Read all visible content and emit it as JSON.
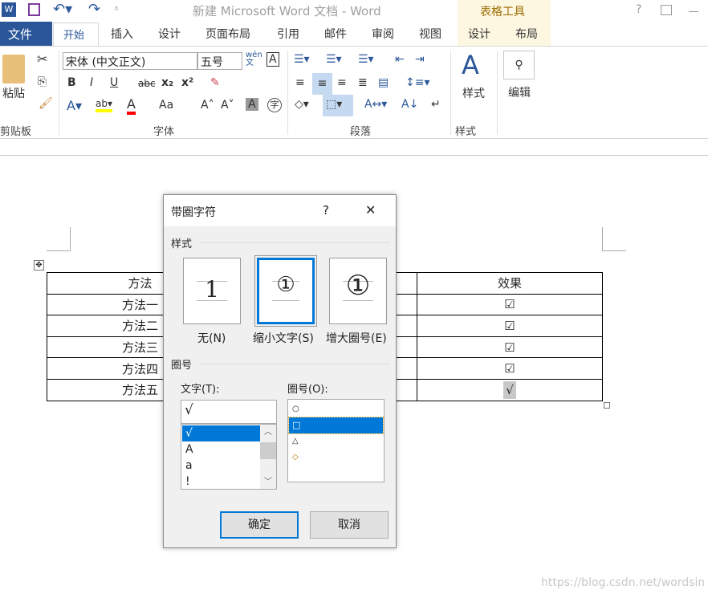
{
  "window": {
    "title": "新建 Microsoft Word 文档 - Word",
    "help": "?",
    "context_tab_group": "表格工具"
  },
  "tabs": {
    "file": "文件",
    "home": "开始",
    "others": [
      "插入",
      "设计",
      "页面布局",
      "引用",
      "邮件",
      "审阅",
      "视图"
    ],
    "context": [
      "设计",
      "布局"
    ]
  },
  "ribbon": {
    "clipboard": {
      "paste": "粘贴",
      "group": "剪贴板"
    },
    "font": {
      "name": "宋体 (中文正文)",
      "size": "五号",
      "bold": "B",
      "italic": "I",
      "underline": "U",
      "strike": "abc",
      "sub": "x₂",
      "sup": "x²",
      "case": "Aa",
      "group": "字体",
      "phonetic": "wén 文",
      "border_char": "A"
    },
    "paragraph": {
      "group": "段落"
    },
    "styles": {
      "label": "样式",
      "group": "样式"
    },
    "editing": {
      "label": "编辑"
    }
  },
  "document": {
    "table": {
      "header": [
        "方法",
        "效果"
      ],
      "rows": [
        [
          "方法一",
          "☑"
        ],
        [
          "方法二",
          "☑"
        ],
        [
          "方法三",
          "☑"
        ],
        [
          "方法四",
          "☑"
        ],
        [
          "方法五",
          "√"
        ]
      ]
    }
  },
  "dialog": {
    "title": "带圈字符",
    "help": "?",
    "close": "✕",
    "style_section": "样式",
    "styles": [
      {
        "label": "无(N)",
        "glyph": "1"
      },
      {
        "label": "缩小文字(S)",
        "glyph": "①",
        "selected": true
      },
      {
        "label": "增大圈号(E)",
        "glyph": "①"
      }
    ],
    "enclose_section": "圈号",
    "text_label": "文字(T):",
    "text_value": "√",
    "text_list": [
      "√",
      "A",
      "a",
      "!"
    ],
    "text_selected": "√",
    "enclosure_label": "圈号(O):",
    "enclosure_list": [
      "○",
      "□",
      "△",
      "◇"
    ],
    "enclosure_selected": "□",
    "ok": "确定",
    "cancel": "取消"
  },
  "watermark": "https://blog.csdn.net/wordsin",
  "colors": {
    "accent": "#2b579a",
    "selection": "#0078d7",
    "highlight": "#ffff00",
    "font_color": "#ff0000"
  }
}
